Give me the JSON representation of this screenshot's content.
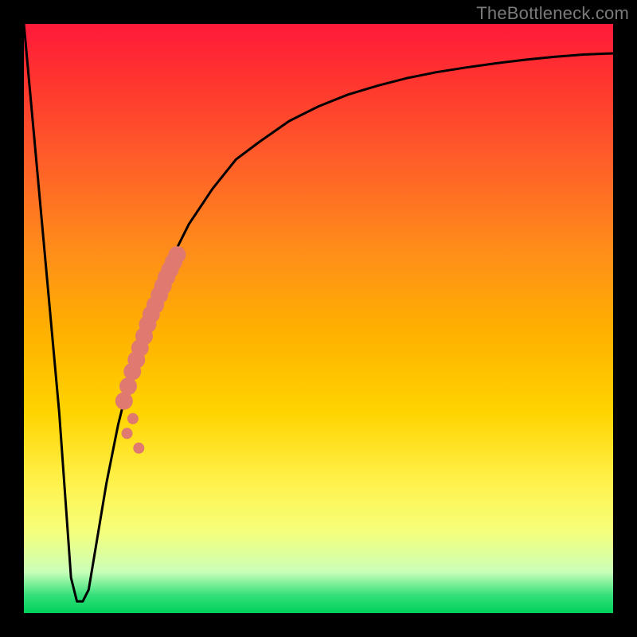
{
  "watermark": {
    "text": "TheBottleneck.com"
  },
  "chart_data": {
    "type": "line",
    "title": "",
    "xlabel": "",
    "ylabel": "",
    "xlim": [
      0,
      100
    ],
    "ylim": [
      0,
      100
    ],
    "grid": false,
    "series": [
      {
        "name": "bottleneck-curve",
        "x": [
          0,
          2,
          4,
          6,
          7,
          8,
          9,
          10,
          11,
          12,
          14,
          16,
          18,
          20,
          22,
          25,
          28,
          32,
          36,
          40,
          45,
          50,
          55,
          60,
          65,
          70,
          75,
          80,
          85,
          90,
          95,
          100
        ],
        "values": [
          100,
          78,
          56,
          34,
          20,
          6,
          2,
          2,
          4,
          10,
          22,
          32,
          40,
          47,
          53,
          60,
          66,
          72,
          77,
          80,
          83.5,
          86,
          88,
          89.5,
          90.8,
          91.8,
          92.6,
          93.3,
          93.9,
          94.4,
          94.8,
          95.0
        ]
      }
    ],
    "points": {
      "name": "highlighted-range",
      "color": "#e07a70",
      "x": [
        17.0,
        17.7,
        18.4,
        19.1,
        19.7,
        20.4,
        21.0,
        21.6,
        22.3,
        23.0,
        23.6,
        24.2,
        24.8,
        25.4,
        26.0,
        17.5,
        18.5,
        19.5
      ],
      "values": [
        36.0,
        38.5,
        41.0,
        43.0,
        45.0,
        47.0,
        49.0,
        50.7,
        52.3,
        54.0,
        55.5,
        57.0,
        58.3,
        59.6,
        60.8,
        30.5,
        33.0,
        28.0
      ]
    },
    "background": "warm-gradient"
  }
}
